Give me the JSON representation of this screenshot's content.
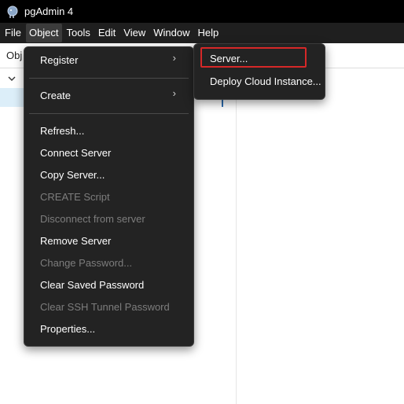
{
  "app": {
    "title": "pgAdmin 4"
  },
  "menubar": {
    "items": [
      "File",
      "Object",
      "Tools",
      "Edit",
      "View",
      "Window",
      "Help"
    ]
  },
  "toolbar": {
    "object_label": "Obj"
  },
  "object_menu": {
    "items": [
      {
        "label": "Register",
        "enabled": true,
        "submenu": true
      },
      {
        "label": "Create",
        "enabled": true,
        "submenu": true
      },
      {
        "label": "Refresh...",
        "enabled": true
      },
      {
        "label": "Connect Server",
        "enabled": true
      },
      {
        "label": "Copy Server...",
        "enabled": true
      },
      {
        "label": "CREATE Script",
        "enabled": false
      },
      {
        "label": "Disconnect from server",
        "enabled": false
      },
      {
        "label": "Remove Server",
        "enabled": true
      },
      {
        "label": "Change Password...",
        "enabled": false
      },
      {
        "label": "Clear Saved Password",
        "enabled": true
      },
      {
        "label": "Clear SSH Tunnel Password",
        "enabled": false
      },
      {
        "label": "Properties...",
        "enabled": true
      }
    ]
  },
  "register_submenu": {
    "items": [
      {
        "label": "Server...",
        "highlighted": true
      },
      {
        "label": "Deploy Cloud Instance..."
      }
    ]
  },
  "colors": {
    "menu_bg": "#232323",
    "highlight_border": "#d62828",
    "disabled_text": "#7d7d7d"
  }
}
